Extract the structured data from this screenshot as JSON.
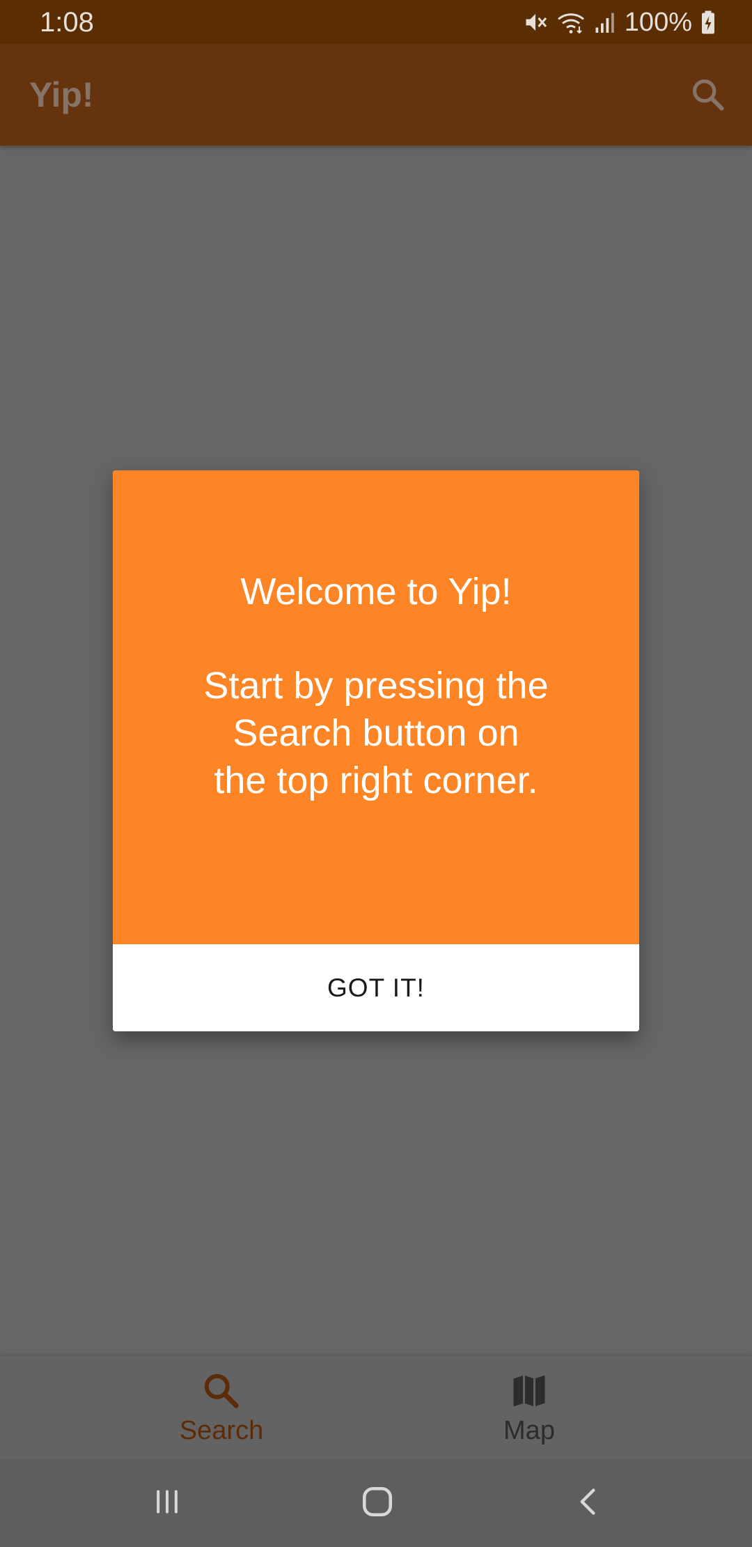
{
  "status_bar": {
    "time": "1:08",
    "battery": "100%",
    "icons": [
      "mute-icon",
      "wifi-icon",
      "signal-icon",
      "battery-charging-icon"
    ]
  },
  "app_bar": {
    "title": "Yip!",
    "search_icon": "search-icon"
  },
  "dialog": {
    "welcome": "Welcome to Yip!",
    "message": "Start by pressing the Search button on the top right corner.",
    "button_label": "GOT IT!",
    "accent_color": "#fe8526"
  },
  "bottom_nav": {
    "items": [
      {
        "label": "Search",
        "icon": "search-icon",
        "selected": true
      },
      {
        "label": "Map",
        "icon": "map-icon",
        "selected": false
      }
    ]
  },
  "system_nav": {
    "buttons": [
      "recents-icon",
      "home-icon",
      "back-icon"
    ]
  },
  "colors": {
    "status_bar": "#5b2d02",
    "app_bar": "#66330f",
    "scrim": "#666666",
    "primary_dark_text": "#5c2c08"
  }
}
